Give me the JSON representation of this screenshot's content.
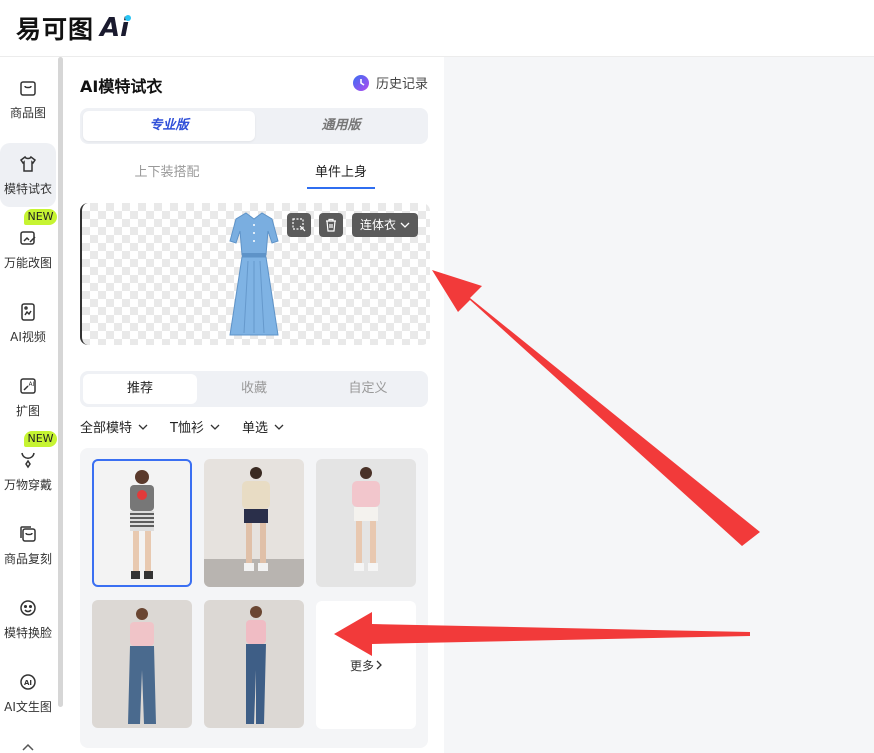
{
  "brand": {
    "logo_text": "易可图",
    "logo_mark": "Ai"
  },
  "sidebar": {
    "items": [
      {
        "label": "商品图",
        "icon": "bag-icon"
      },
      {
        "label": "模特试衣",
        "icon": "tshirt-icon"
      },
      {
        "label": "万能改图",
        "icon": "edit-image-icon"
      },
      {
        "label": "AI视频",
        "icon": "video-doc-icon"
      },
      {
        "label": "扩图",
        "icon": "expand-image-icon"
      },
      {
        "label": "万物穿戴",
        "icon": "necklace-icon"
      },
      {
        "label": "商品复刻",
        "icon": "copy-bag-icon"
      },
      {
        "label": "模特换脸",
        "icon": "face-icon"
      },
      {
        "label": "AI文生图",
        "icon": "ai-circle-icon"
      }
    ],
    "badge": "NEW"
  },
  "panel": {
    "title": "AI模特试衣",
    "history_label": "历史记录",
    "version_tabs": [
      "专业版",
      "通用版"
    ],
    "sub_tabs": [
      "上下装搭配",
      "单件上身"
    ],
    "garment_type": "连体衣",
    "model_tabs": [
      "推荐",
      "收藏",
      "自定义"
    ],
    "filters": [
      "全部模特",
      "T恤衫",
      "单选"
    ],
    "more_label": "更多"
  },
  "colors": {
    "accent": "#2f4fd8",
    "new_badge": "#c6f432",
    "arrow": "#f23a3a"
  }
}
